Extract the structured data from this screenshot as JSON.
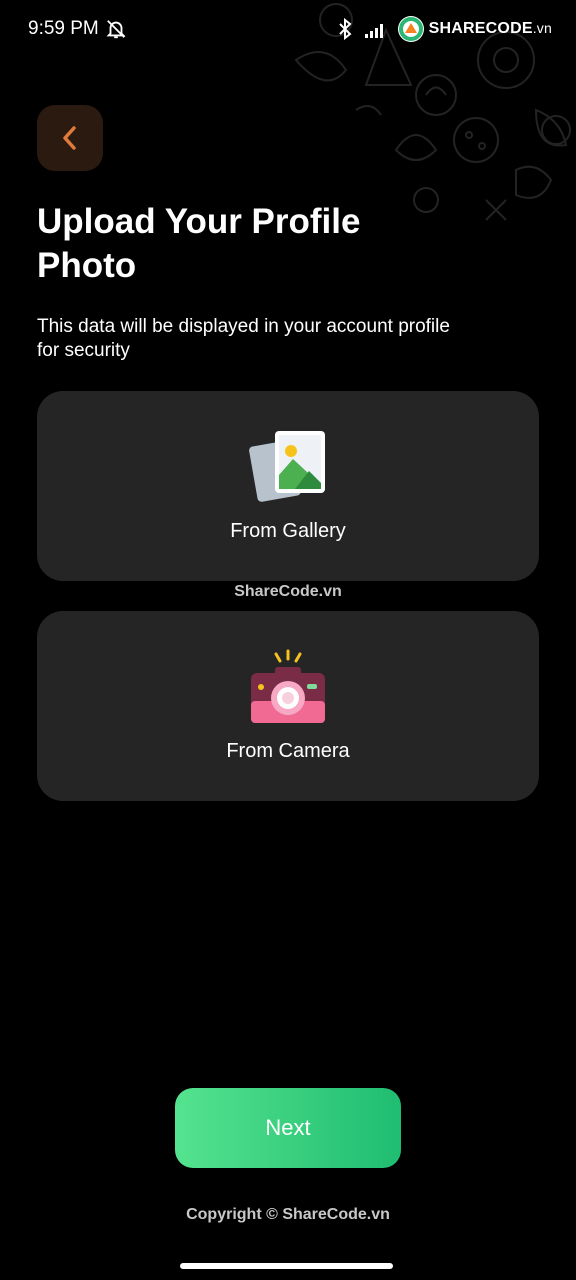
{
  "status_bar": {
    "time": "9:59 PM",
    "brand_name": "SHARECODE",
    "brand_suffix": ".vn"
  },
  "header": {
    "title": "Upload Your Profile Photo",
    "subtitle": "This data will be displayed in your account profile for security"
  },
  "options": [
    {
      "label": "From Gallery",
      "icon": "gallery-icon"
    },
    {
      "label": "From Camera",
      "icon": "camera-icon"
    }
  ],
  "watermark": "ShareCode.vn",
  "next_button": {
    "label": "Next"
  },
  "footer": {
    "copyright": "Copyright © ShareCode.vn"
  },
  "colors": {
    "background": "#000000",
    "card": "#252525",
    "accent": "#e07a3a",
    "next_gradient_start": "#55e38f",
    "next_gradient_end": "#1fbd71"
  }
}
